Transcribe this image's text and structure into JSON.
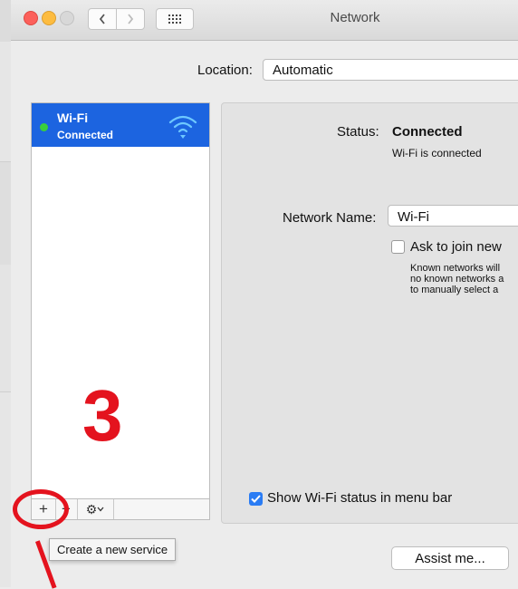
{
  "window": {
    "title": "Network",
    "nav": {
      "back_icon": "chevron-left-icon",
      "forward_icon": "chevron-right-icon",
      "grid_icon": "show-all-grid-icon"
    }
  },
  "location": {
    "label": "Location:",
    "value": "Automatic"
  },
  "services": [
    {
      "name": "Wi-Fi",
      "status": "Connected",
      "status_color": "#39cf3c",
      "icon": "wifi-icon",
      "selected": true
    }
  ],
  "annotation": {
    "number": "3",
    "color": "#e4131e"
  },
  "toolbar": {
    "add_label": "+",
    "remove_label": "−",
    "gear_icon": "gear-icon"
  },
  "tooltip": "Create a new service",
  "detail": {
    "status_label": "Status:",
    "status_value": "Connected",
    "status_detail": "Wi-Fi is connected",
    "network_name_label": "Network Name:",
    "network_name_value": "Wi-Fi",
    "ask_label": "Ask to join new",
    "ask_checked": false,
    "ask_note": "Known networks will\nno known networks a\nto manually select a",
    "show_status_label": "Show Wi-Fi status in menu bar",
    "show_status_checked": true
  },
  "assist_label": "Assist me...",
  "colors": {
    "selection": "#1c64e0",
    "checkbox_on": "#2a7cf4"
  }
}
